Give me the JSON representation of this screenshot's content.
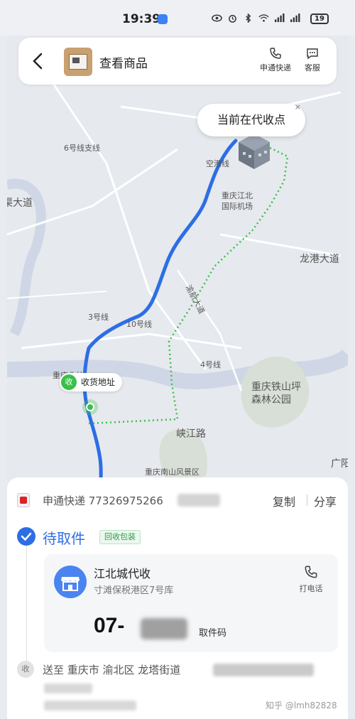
{
  "status_bar": {
    "time": "19:39",
    "battery": "19",
    "icons": [
      "eye-icon",
      "alarm-icon",
      "bluetooth-icon",
      "wifi-icon",
      "signal-icon",
      "signal-icon-2"
    ]
  },
  "header": {
    "title": "查看商品",
    "courier_label": "申通快递",
    "service_label": "客服"
  },
  "map": {
    "bubble_text": "当前在代收点",
    "bubble_close": "×",
    "address_tag": "收货地址",
    "address_tag_badge": "收",
    "labels": {
      "line6_branch": "6号线支线",
      "kongang": "空港线",
      "airport": "重庆江北\n国际机场",
      "road_left": "渠大道",
      "longgang": "龙港大道",
      "yuhang": "渝航大道",
      "line3": "3号线",
      "line10": "10号线",
      "line4": "4号线",
      "tieshanping": "重庆铁山坪\n森林公园",
      "chongbei": "重庆北站",
      "xiajiang": "峡江路",
      "nanshan": "重庆南山风景区",
      "guangyang": "广阳"
    }
  },
  "sheet": {
    "tracking": "申通快递 77326975266",
    "copy": "复制",
    "share": "分享",
    "status": "待取件",
    "status_tag": "回收包装",
    "store_name": "江北城代收",
    "store_address": "寸滩保税港区7号库",
    "call": "打电话",
    "pickup_code": "07-",
    "pickup_code_label": "取件码",
    "recv_badge": "收",
    "recv_address": "送至 重庆市 渝北区 龙塔街道",
    "watermark": "知乎 @lmh82828"
  },
  "colors": {
    "route_blue": "#2d6ee5",
    "route_green": "#3cbf4a"
  }
}
